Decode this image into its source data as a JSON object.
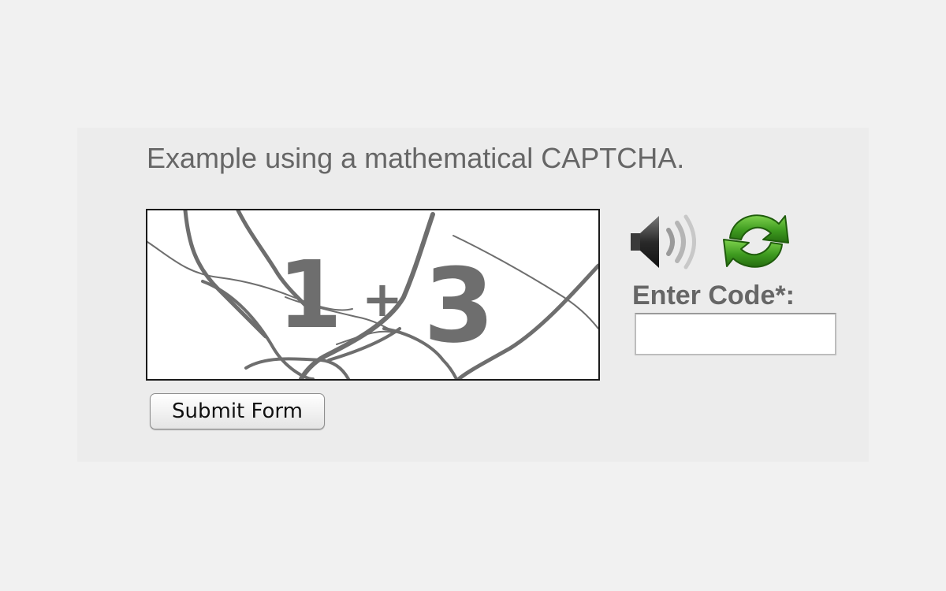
{
  "heading": "Example using a mathematical CAPTCHA.",
  "captcha": {
    "left_digit": "1",
    "operator": "+",
    "right_digit": "3",
    "text_color": "#6e6e6e",
    "line_color": "#6e6e6e"
  },
  "audio": {
    "icon": "speaker-icon"
  },
  "refresh": {
    "icon": "refresh-icon",
    "color": "#3e9a1f"
  },
  "code_field": {
    "label": "Enter Code*:",
    "value": ""
  },
  "submit": {
    "label": "Submit Form"
  }
}
